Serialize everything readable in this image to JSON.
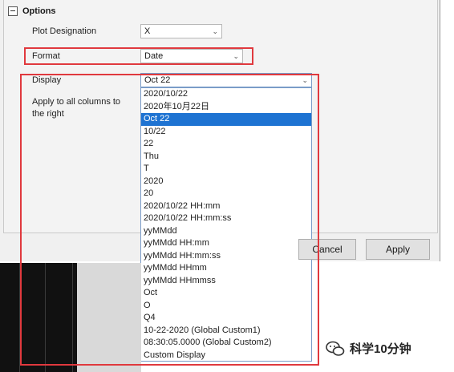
{
  "options": {
    "title": "Options",
    "plot_designation": {
      "label": "Plot Designation",
      "value": "X"
    },
    "format": {
      "label": "Format",
      "value": "Date"
    },
    "display": {
      "label": "Display",
      "value": "Oct 22"
    },
    "apply_all": {
      "label_line1": "Apply to all columns to",
      "label_line2": "the right"
    }
  },
  "dropdown": {
    "items": [
      "2020/10/22",
      "2020年10月22日",
      "Oct 22",
      "10/22",
      "22",
      "Thu",
      "T",
      "2020",
      "20",
      "2020/10/22 HH:mm",
      "2020/10/22 HH:mm:ss",
      "yyMMdd",
      "yyMMdd HH:mm",
      "yyMMdd HH:mm:ss",
      "yyMMdd HHmm",
      "yyMMdd HHmmss",
      "Oct",
      "O",
      "Q4",
      "10-22-2020 (Global Custom1)",
      "08:30:05.0000 (Global Custom2)",
      "Custom Display"
    ],
    "selected_index": 2
  },
  "buttons": {
    "cancel": "Cancel",
    "apply": "Apply"
  },
  "watermark": {
    "text": "科学10分钟"
  },
  "colors": {
    "highlight": "#e0393e",
    "selection": "#1e73d2"
  }
}
